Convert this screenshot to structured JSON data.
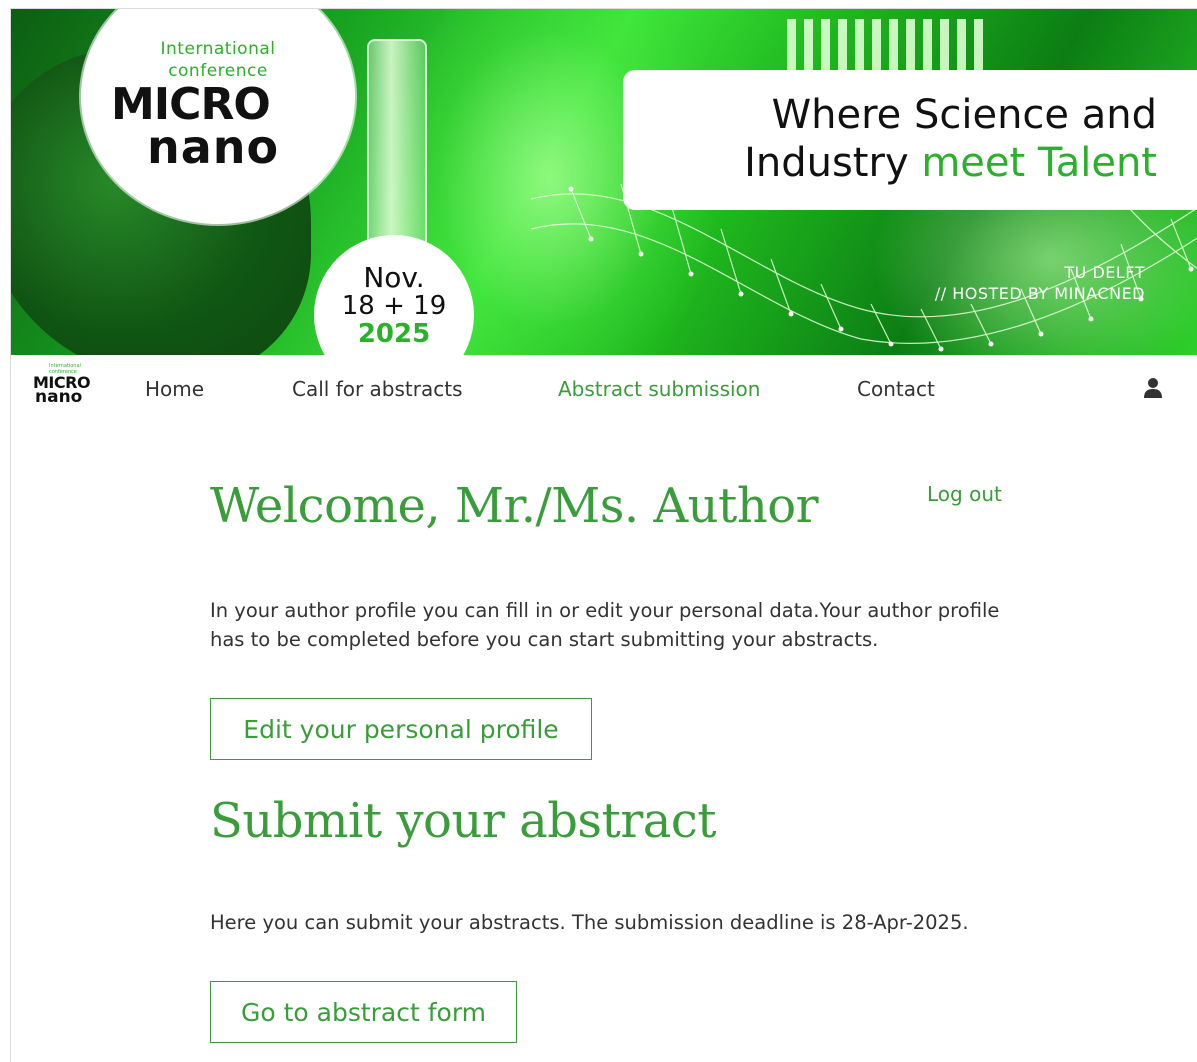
{
  "banner": {
    "logo_line1": "International",
    "logo_line2": "conference",
    "logo_micro": "MICRO",
    "logo_nano": "nano",
    "date_month": "Nov.",
    "date_days": "18 + 19",
    "date_year": "2025",
    "tagline_line1": "Where Science and",
    "tagline_line2_a": "Industry ",
    "tagline_line2_b": "meet Talent",
    "host_line1": "TU DELFT",
    "host_line2": "// HOSTED BY MINACNED"
  },
  "nav": {
    "logo_small1": "International",
    "logo_small2": "conference",
    "logo_micro": "MICRO",
    "logo_nano": "nano",
    "items": [
      {
        "label": "Home",
        "active": false
      },
      {
        "label": "Call for abstracts",
        "active": false
      },
      {
        "label": "Abstract submission",
        "active": true
      },
      {
        "label": "Contact",
        "active": false
      }
    ],
    "user_icon": "user-icon"
  },
  "main": {
    "welcome_title": "Welcome, Mr./Ms. Author",
    "logout_label": "Log out",
    "profile_text": "In your author profile you can fill in or edit your personal data.Your author profile has to be completed before you can start submitting your abstracts.",
    "profile_button": "Edit your personal profile",
    "submit_title": "Submit your abstract",
    "submit_text": "Here you can submit your abstracts. The submission deadline is 28-Apr-2025.",
    "submit_button": "Go to abstract form"
  },
  "colors": {
    "accent": "#3a9c3a",
    "brand_green": "#2bb02b",
    "text": "#333333"
  }
}
